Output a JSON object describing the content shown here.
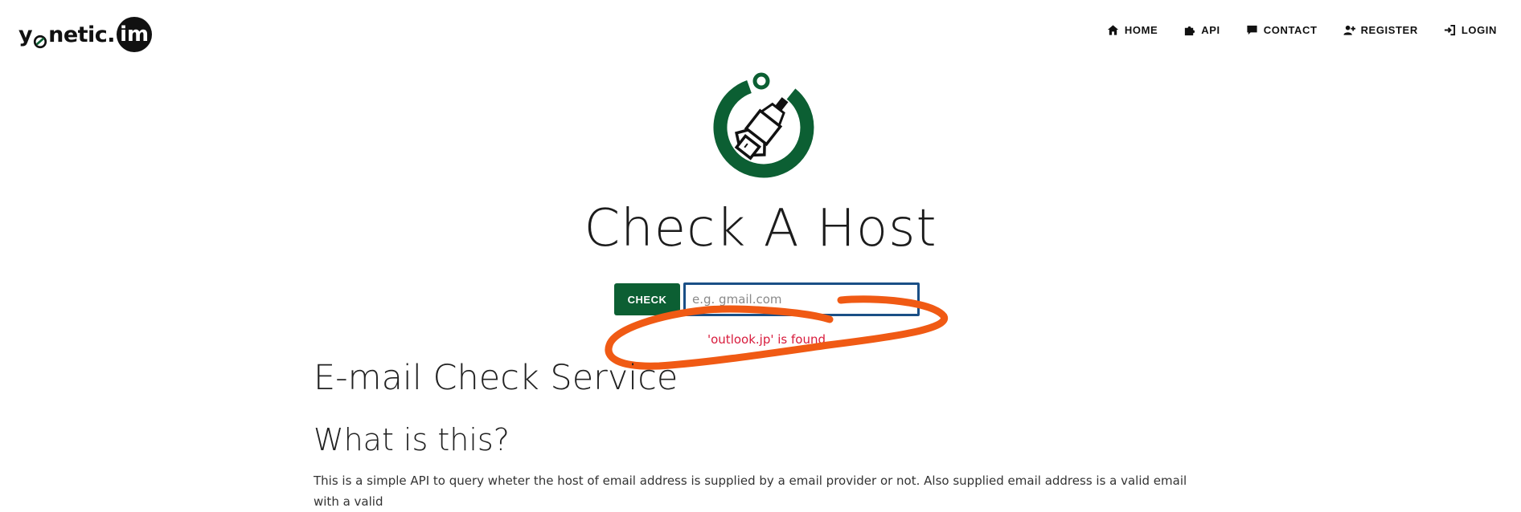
{
  "brand": {
    "logo_prefix": "y",
    "logo_suffix": "netic.",
    "logo_badge": "im",
    "accent_color": "#0c5f33"
  },
  "nav": {
    "items": [
      {
        "label": "HOME",
        "icon": "home-icon"
      },
      {
        "label": "API",
        "icon": "puzzle-icon"
      },
      {
        "label": "CONTACT",
        "icon": "chat-icon"
      },
      {
        "label": "REGISTER",
        "icon": "user-plus-icon"
      },
      {
        "label": "LOGIN",
        "icon": "login-icon"
      }
    ]
  },
  "hero": {
    "title": "Check A Host",
    "check_label": "CHECK",
    "input_placeholder": "e.g. gmail.com",
    "input_value": "",
    "result": "'outlook.jp' is found."
  },
  "content": {
    "section_title": "E-mail Check Service",
    "sub_title": "What is this?",
    "body": "This is a simple API to query wheter the host of email address is supplied by a email provider or not. Also supplied email address is a valid email with a valid"
  },
  "colors": {
    "error": "#d81b3c",
    "input_border": "#1a4f86",
    "annotation": "#f05a14"
  }
}
